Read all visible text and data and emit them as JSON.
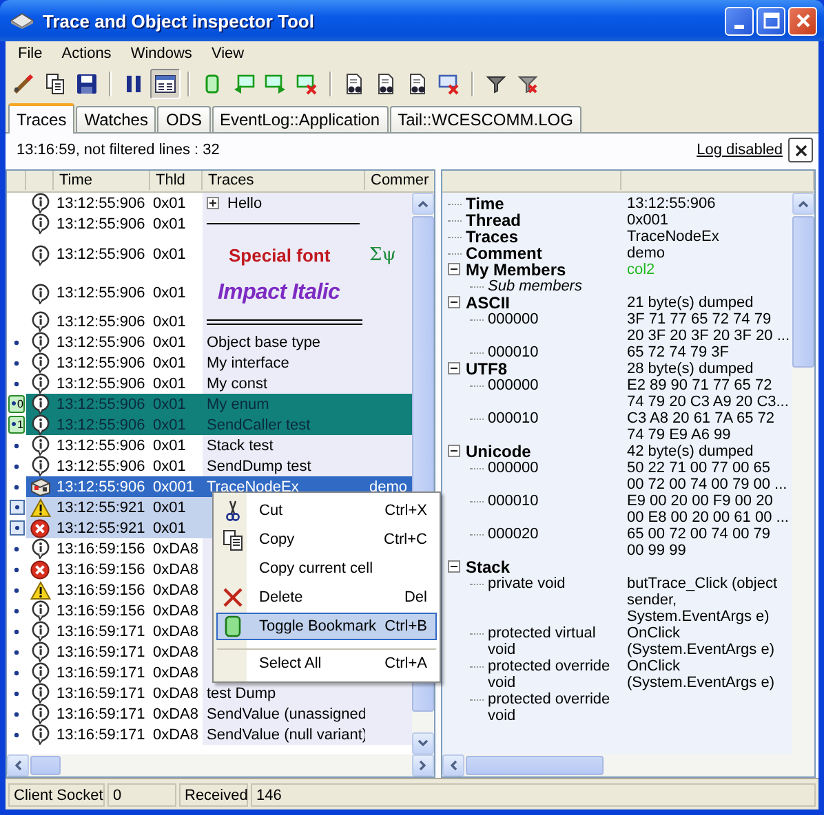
{
  "window": {
    "title": "Trace and Object inspector Tool"
  },
  "menu": [
    "File",
    "Actions",
    "Windows",
    "View"
  ],
  "toolbar": [
    [
      {
        "pressed": false
      },
      {
        "pressed": false
      },
      {
        "pressed": false
      }
    ],
    [
      {
        "pressed": false
      },
      {
        "pressed": true
      }
    ],
    [
      {
        "pressed": false
      },
      {
        "pressed": false
      },
      {
        "pressed": false
      },
      {
        "pressed": false
      }
    ],
    [
      {
        "pressed": false
      },
      {
        "pressed": false
      },
      {
        "pressed": false
      },
      {
        "pressed": false
      }
    ],
    [
      {
        "pressed": false
      },
      {
        "pressed": false
      }
    ]
  ],
  "tabs": [
    {
      "label": "Traces",
      "selected": true
    },
    {
      "label": "Watches",
      "selected": false
    },
    {
      "label": "ODS",
      "selected": false
    },
    {
      "label": "EventLog::Application",
      "selected": false
    },
    {
      "label": "Tail::WCESCOMM.LOG",
      "selected": false
    }
  ],
  "info": {
    "status": "13:16:59, not filtered lines : 32",
    "link": "Log disabled"
  },
  "traces": {
    "columns": [
      "Time",
      "Thld",
      "Traces",
      "Commer"
    ],
    "rows": [
      {
        "kind": "info",
        "time": "13:12:55:906",
        "thread": "0x01",
        "trace": {
          "kind": "plain",
          "text": "Hello"
        },
        "expanded": false,
        "dot": false,
        "selected": false,
        "focused": false
      },
      {
        "kind": "info",
        "time": "13:12:55:906",
        "thread": "0x01",
        "trace": {
          "kind": "separator"
        },
        "dot": false,
        "selected": false,
        "focused": false
      },
      {
        "kind": "info",
        "time": "13:12:55:906",
        "thread": "0x01",
        "trace": {
          "kind": "special_font",
          "text": "Special font"
        },
        "comment": "Σψ",
        "dot": false,
        "selected": false,
        "focused": false
      },
      {
        "kind": "info",
        "time": "13:12:55:906",
        "thread": "0x01",
        "trace": {
          "kind": "impact",
          "text": "Impact Italic"
        },
        "dot": false,
        "selected": false,
        "focused": false
      },
      {
        "kind": "info",
        "time": "13:12:55:906",
        "thread": "0x01",
        "trace": {
          "kind": "double_separator"
        },
        "dot": false,
        "selected": false,
        "focused": false
      },
      {
        "kind": "info",
        "time": "13:12:55:906",
        "thread": "0x01",
        "trace": {
          "kind": "plain",
          "text": "Object base type"
        },
        "dot": true,
        "selected": false,
        "focused": false
      },
      {
        "kind": "info",
        "time": "13:12:55:906",
        "thread": "0x01",
        "trace": {
          "kind": "plain",
          "text": "My interface"
        },
        "dot": true,
        "selected": false,
        "focused": false
      },
      {
        "kind": "info",
        "time": "13:12:55:906",
        "thread": "0x01",
        "trace": {
          "kind": "plain",
          "text": "My const"
        },
        "dot": true,
        "selected": false,
        "focused": false
      },
      {
        "kind": "info",
        "time": "13:12:55:906",
        "thread": "0x01",
        "trace": {
          "kind": "plain",
          "text": "My enum"
        },
        "bookmark": "0",
        "dot": true,
        "selected": false,
        "focused": false
      },
      {
        "kind": "info",
        "time": "13:12:55:906",
        "thread": "0x01",
        "trace": {
          "kind": "plain",
          "text": "SendCaller test"
        },
        "bookmark": "1",
        "dot": true,
        "selected": false,
        "focused": false
      },
      {
        "kind": "info",
        "time": "13:12:55:906",
        "thread": "0x01",
        "trace": {
          "kind": "plain",
          "text": "Stack test"
        },
        "dot": true,
        "selected": false,
        "focused": false
      },
      {
        "kind": "info",
        "time": "13:12:55:906",
        "thread": "0x01",
        "trace": {
          "kind": "plain",
          "text": "SendDump test"
        },
        "dot": true,
        "selected": false,
        "focused": false
      },
      {
        "kind": "object",
        "time": "13:12:55:906",
        "thread": "0x001",
        "trace": {
          "kind": "plain",
          "text": "TraceNodeEx"
        },
        "comment": "demo",
        "dot": true,
        "selected": true,
        "focused": true
      },
      {
        "kind": "warning",
        "time": "13:12:55:921",
        "thread": "0x01",
        "dot": true,
        "selected": true,
        "focused": false
      },
      {
        "kind": "error",
        "time": "13:12:55:921",
        "thread": "0x01",
        "dot": true,
        "selected": true,
        "focused": false
      },
      {
        "kind": "info",
        "time": "13:16:59:156",
        "thread": "0xDA8",
        "dot": true,
        "selected": false,
        "focused": false
      },
      {
        "kind": "error",
        "time": "13:16:59:156",
        "thread": "0xDA8",
        "dot": true,
        "selected": false,
        "focused": false
      },
      {
        "kind": "warning",
        "time": "13:16:59:156",
        "thread": "0xDA8",
        "dot": true,
        "selected": false,
        "focused": false
      },
      {
        "kind": "info",
        "time": "13:16:59:156",
        "thread": "0xDA8",
        "dot": true,
        "selected": false,
        "focused": false
      },
      {
        "kind": "info",
        "time": "13:16:59:171",
        "thread": "0xDA8",
        "dot": true,
        "selected": false,
        "focused": false
      },
      {
        "kind": "info",
        "time": "13:16:59:171",
        "thread": "0xDA8",
        "dot": true,
        "selected": false,
        "focused": false
      },
      {
        "kind": "info",
        "time": "13:16:59:171",
        "thread": "0xDA8",
        "dot": true,
        "selected": false,
        "focused": false
      },
      {
        "kind": "info",
        "time": "13:16:59:171",
        "thread": "0xDA8",
        "trace": {
          "kind": "plain",
          "text": "test Dump"
        },
        "dot": true,
        "selected": false,
        "focused": false
      },
      {
        "kind": "info",
        "time": "13:16:59:171",
        "thread": "0xDA8",
        "trace": {
          "kind": "plain",
          "text": "SendValue (unassigned"
        },
        "dot": true,
        "selected": false,
        "focused": false
      },
      {
        "kind": "info",
        "time": "13:16:59:171",
        "thread": "0xDA8",
        "trace": {
          "kind": "plain",
          "text": "SendValue (null variant)"
        },
        "dot": true,
        "selected": false,
        "focused": false
      }
    ]
  },
  "details": [
    {
      "name": "Time",
      "value": "13:12:55:906"
    },
    {
      "name": "Thread",
      "value": "0x001"
    },
    {
      "name": "Traces",
      "value": "TraceNodeEx"
    },
    {
      "name": "Comment",
      "value": "demo"
    },
    {
      "name": "My Members",
      "value": "col2",
      "color": "#1fb81f",
      "expanded": true,
      "children": [
        {
          "kind": "note",
          "name": "Sub members"
        }
      ]
    },
    {
      "name": "ASCII",
      "value": "21 byte(s) dumped",
      "expanded": true,
      "children": [
        {
          "name": "000000",
          "value": "3F 71 77 65 72 74 79 20 3F 20 3F 20 3F 20 ..."
        },
        {
          "name": "000010",
          "value": "65 72 74 79 3F"
        }
      ]
    },
    {
      "name": "UTF8",
      "value": "28 byte(s) dumped",
      "expanded": true,
      "children": [
        {
          "name": "000000",
          "value": "E2 89 90 71 77 65 72 74 79 20 C3 A9 20 C3..."
        },
        {
          "name": "000010",
          "value": "C3 A8 20 61 7A 65 72 74 79 E9 A6 99"
        }
      ]
    },
    {
      "name": "Unicode",
      "value": "42 byte(s) dumped",
      "expanded": true,
      "children": [
        {
          "name": "000000",
          "value": "50 22 71 00 77 00 65 00 72 00 74 00 79 00 ..."
        },
        {
          "name": "000010",
          "value": "E9 00 20 00 F9 00 20 00 E8 00 20 00 61 00 ..."
        },
        {
          "name": "000020",
          "value": "65 00 72 00 74 00 79 00 99 99"
        }
      ]
    },
    {
      "name": "Stack",
      "expanded": true,
      "children": [
        {
          "name": "private void",
          "value": "butTrace_Click (object sender, System.EventArgs e)"
        },
        {
          "name": "protected virtual void",
          "value": "OnClick (System.EventArgs e)"
        },
        {
          "name": "protected override void",
          "value": "OnClick (System.EventArgs e)"
        },
        {
          "name": "protected override void"
        }
      ]
    }
  ],
  "context_menu": [
    {
      "kind": "cut",
      "label": "Cut",
      "shortcut": "Ctrl+X",
      "highlighted": false,
      "separator_before": false
    },
    {
      "kind": "copy",
      "label": "Copy",
      "shortcut": "Ctrl+C",
      "highlighted": false,
      "separator_before": false
    },
    {
      "kind": "plain",
      "label": "Copy current cell",
      "highlighted": false,
      "separator_before": false
    },
    {
      "kind": "delete",
      "label": "Delete",
      "shortcut": "Del",
      "highlighted": false,
      "separator_before": false
    },
    {
      "kind": "bookmark",
      "label": "Toggle Bookmark",
      "shortcut": "Ctrl+B",
      "highlighted": true,
      "separator_before": false
    },
    {
      "kind": "plain",
      "label": "Select All",
      "shortcut": "Ctrl+A",
      "highlighted": false,
      "separator_before": true
    }
  ],
  "status_bar": [
    "Client Socket",
    "0",
    "Received",
    "146"
  ]
}
